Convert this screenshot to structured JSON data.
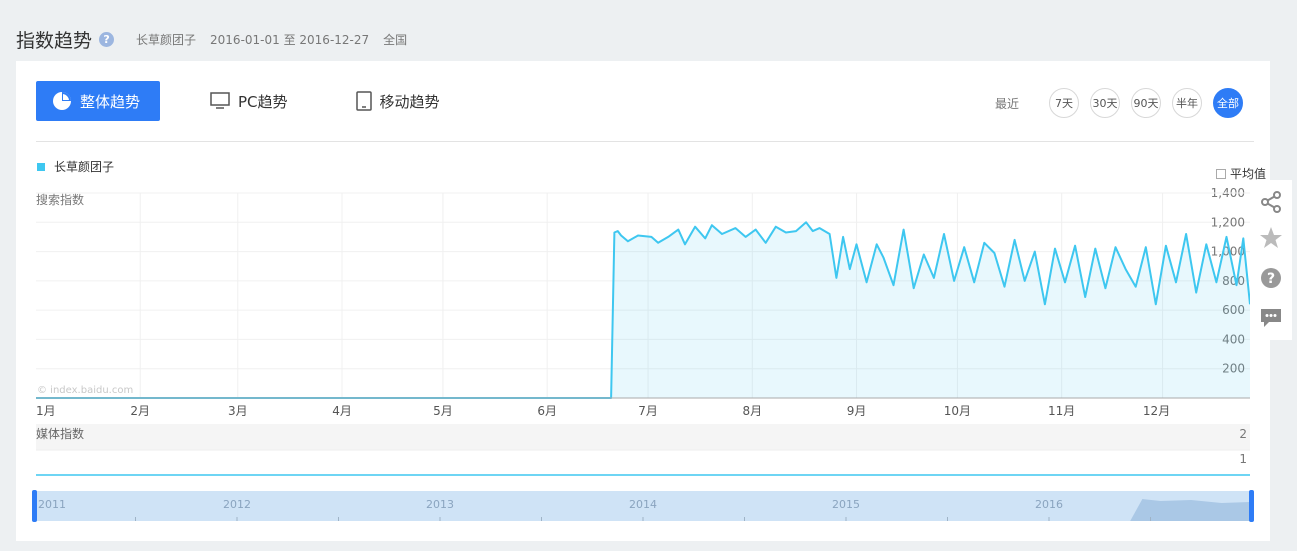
{
  "header": {
    "title": "指数趋势",
    "help": "?",
    "keyword": "长草颜团子",
    "date_range": "2016-01-01 至 2016-12-27",
    "region": "全国"
  },
  "tabs": [
    {
      "label": "整体趋势",
      "active": true
    },
    {
      "label": "PC趋势",
      "active": false
    },
    {
      "label": "移动趋势",
      "active": false
    }
  ],
  "range": {
    "label": "最近",
    "options": [
      "7天",
      "30天",
      "90天",
      "半年",
      "全部"
    ],
    "active": "全部"
  },
  "legend": {
    "series": "长草颜团子"
  },
  "average_label": "平均值",
  "watermark": "© index.baidu.com",
  "colors": {
    "accent": "#2e7cf6",
    "series": "#3ec7f0"
  },
  "chart_data": [
    {
      "type": "line",
      "ylabel": "搜索指数",
      "yticks": [
        "200",
        "400",
        "600",
        "800",
        "1,000",
        "1,200",
        "1,400"
      ],
      "ylim": [
        0,
        1400
      ],
      "xticks": [
        "1月",
        "2月",
        "3月",
        "4月",
        "5月",
        "6月",
        "7月",
        "8月",
        "9月",
        "10月",
        "11月",
        "12月"
      ],
      "x_start": "2016-01-01",
      "x_end": "2016-12-27",
      "series": [
        {
          "name": "长草颜团子",
          "points": [
            [
              "2016-01-01",
              0
            ],
            [
              "2016-06-20",
              0
            ],
            [
              "2016-06-21",
              1130
            ],
            [
              "2016-06-22",
              1140
            ],
            [
              "2016-06-23",
              1110
            ],
            [
              "2016-06-25",
              1070
            ],
            [
              "2016-06-28",
              1110
            ],
            [
              "2016-07-02",
              1100
            ],
            [
              "2016-07-04",
              1060
            ],
            [
              "2016-07-07",
              1100
            ],
            [
              "2016-07-10",
              1150
            ],
            [
              "2016-07-12",
              1050
            ],
            [
              "2016-07-15",
              1170
            ],
            [
              "2016-07-18",
              1090
            ],
            [
              "2016-07-20",
              1180
            ],
            [
              "2016-07-23",
              1120
            ],
            [
              "2016-07-27",
              1160
            ],
            [
              "2016-07-30",
              1100
            ],
            [
              "2016-08-02",
              1150
            ],
            [
              "2016-08-05",
              1060
            ],
            [
              "2016-08-08",
              1170
            ],
            [
              "2016-08-11",
              1130
            ],
            [
              "2016-08-14",
              1140
            ],
            [
              "2016-08-17",
              1200
            ],
            [
              "2016-08-19",
              1140
            ],
            [
              "2016-08-21",
              1160
            ],
            [
              "2016-08-24",
              1120
            ],
            [
              "2016-08-26",
              820
            ],
            [
              "2016-08-28",
              1100
            ],
            [
              "2016-08-30",
              880
            ],
            [
              "2016-09-01",
              1050
            ],
            [
              "2016-09-04",
              790
            ],
            [
              "2016-09-07",
              1050
            ],
            [
              "2016-09-09",
              960
            ],
            [
              "2016-09-12",
              770
            ],
            [
              "2016-09-15",
              1150
            ],
            [
              "2016-09-18",
              750
            ],
            [
              "2016-09-21",
              980
            ],
            [
              "2016-09-24",
              820
            ],
            [
              "2016-09-27",
              1120
            ],
            [
              "2016-09-30",
              800
            ],
            [
              "2016-10-03",
              1030
            ],
            [
              "2016-10-06",
              790
            ],
            [
              "2016-10-09",
              1060
            ],
            [
              "2016-10-12",
              990
            ],
            [
              "2016-10-15",
              760
            ],
            [
              "2016-10-18",
              1080
            ],
            [
              "2016-10-21",
              800
            ],
            [
              "2016-10-24",
              1000
            ],
            [
              "2016-10-27",
              640
            ],
            [
              "2016-10-30",
              1020
            ],
            [
              "2016-11-02",
              790
            ],
            [
              "2016-11-05",
              1040
            ],
            [
              "2016-11-08",
              690
            ],
            [
              "2016-11-11",
              1020
            ],
            [
              "2016-11-14",
              750
            ],
            [
              "2016-11-17",
              1030
            ],
            [
              "2016-11-20",
              880
            ],
            [
              "2016-11-23",
              760
            ],
            [
              "2016-11-26",
              1030
            ],
            [
              "2016-11-29",
              640
            ],
            [
              "2016-12-02",
              1040
            ],
            [
              "2016-12-05",
              790
            ],
            [
              "2016-12-08",
              1120
            ],
            [
              "2016-12-11",
              720
            ],
            [
              "2016-12-14",
              1050
            ],
            [
              "2016-12-17",
              790
            ],
            [
              "2016-12-20",
              1100
            ],
            [
              "2016-12-23",
              770
            ],
            [
              "2016-12-25",
              1090
            ],
            [
              "2016-12-27",
              640
            ]
          ]
        }
      ]
    },
    {
      "type": "line",
      "ylabel": "媒体指数",
      "yticks": [
        "1",
        "2"
      ],
      "ylim": [
        0,
        2
      ],
      "series": [
        {
          "points": [
            [
              "2016-01-01",
              0
            ],
            [
              "2016-12-27",
              0
            ]
          ]
        }
      ]
    },
    {
      "type": "area",
      "xticks": [
        "2011",
        "2012",
        "2013",
        "2014",
        "2015",
        "2016"
      ]
    }
  ]
}
